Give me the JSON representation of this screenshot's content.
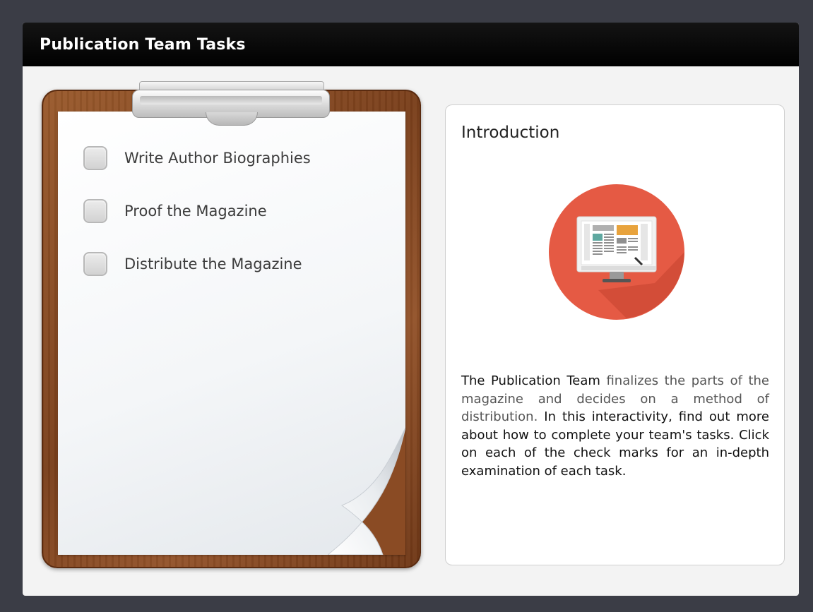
{
  "window": {
    "title": "Publication Team Tasks"
  },
  "tasks": [
    {
      "label": "Write Author Biographies",
      "checked": false
    },
    {
      "label": "Proof the Magazine",
      "checked": false
    },
    {
      "label": "Distribute the Magazine",
      "checked": false
    }
  ],
  "intro": {
    "title": "Introduction",
    "icon": "monitor-layout-icon",
    "text_bold": "The Publication Team",
    "text_muted": " finalizes the parts of the magazine and decides on a method of distribution.",
    "text_rest": " In this interactivity, find out more about how to complete your team's tasks. Click on each of the check marks for an in-depth examination of each task."
  },
  "colors": {
    "background": "#3b3d46",
    "titlebar": "#000000",
    "icon_circle": "#e55a44",
    "icon_shadow": "#c4432f",
    "clipboard_wood": "#8a4b24"
  }
}
